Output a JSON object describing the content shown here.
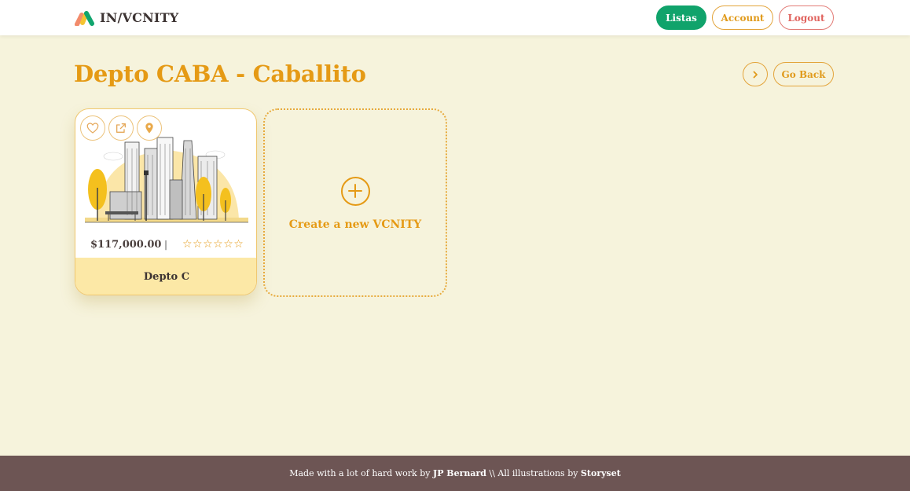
{
  "header": {
    "brand": "IN/VCNITY",
    "nav": {
      "listas": "Listas",
      "account": "Account",
      "logout": "Logout"
    }
  },
  "page": {
    "title": "Depto CABA - Caballito",
    "go_back": "Go Back"
  },
  "cards": [
    {
      "price": "$117,000.00",
      "separator": "|",
      "rating": "☆☆☆☆☆☆",
      "name": "Depto C"
    }
  ],
  "create_card": {
    "label": "Create a new VCNITY"
  },
  "footer": {
    "prefix": "Made with a lot of hard work by ",
    "author": "JP Bernard",
    "middle": " \\\\ All illustrations by ",
    "credit": "Storyset"
  },
  "colors": {
    "accent": "#e59a15",
    "listas_green": "#10a36b",
    "logout_red": "#e0625d",
    "background": "#f6f3dc",
    "footer_bg": "#6d5554"
  },
  "icons": [
    "logo-icon",
    "heart-icon",
    "external-link-icon",
    "location-pin-icon",
    "chevron-right-icon",
    "plus-icon",
    "star-icon"
  ]
}
